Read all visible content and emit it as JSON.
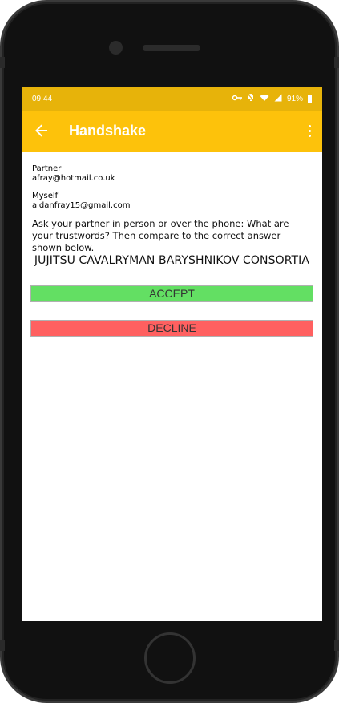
{
  "status_bar": {
    "time": "09:44",
    "key_icon": "key-icon",
    "mute_icon": "notifications-off-icon",
    "wifi_icon": "wifi-icon",
    "signal_icon": "signal-icon",
    "battery_percent": "91%",
    "battery_icon": "battery-icon"
  },
  "app_bar": {
    "back_icon": "arrow-back-icon",
    "title": "Handshake",
    "menu_icon": "more-vert-icon",
    "background_color": "#fdc20b",
    "status_color": "#e7b30a"
  },
  "partner": {
    "label": "Partner",
    "email": "afray@hotmail.co.uk"
  },
  "myself": {
    "label": "Myself",
    "email": "aidanfray15@gmail.com"
  },
  "question": "Ask your partner in person or over the phone: What are your trustwords? Then compare to the correct answer shown below.",
  "trustwords": "JUJITSU CAVALRYMAN BARYSHNIKOV CONSORTIA",
  "actions": {
    "accept_label": "ACCEPT",
    "accept_color": "#63df63",
    "decline_label": "DECLINE",
    "decline_color": "#ff6060"
  }
}
